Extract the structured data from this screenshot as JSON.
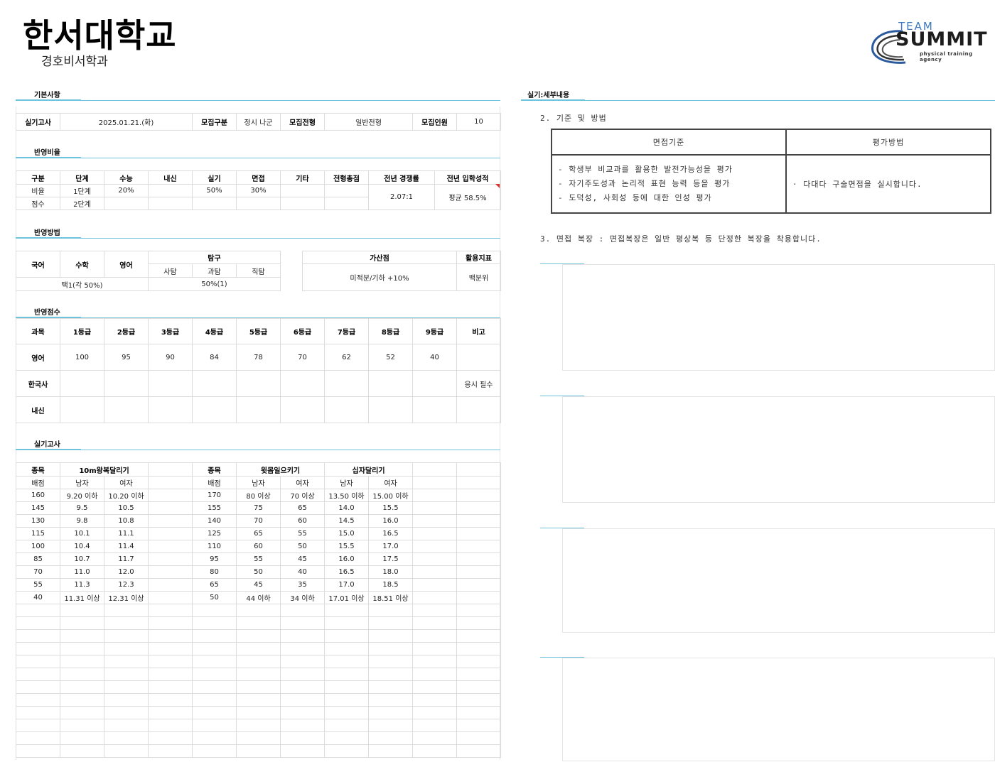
{
  "header": {
    "university": "한서대학교",
    "department": "경호비서학과"
  },
  "logo": {
    "team": "TEAM",
    "summit": "SUMMIT",
    "tagline": "physical training agency"
  },
  "basic": {
    "title": "기본사항",
    "exam_date_label": "실기고사",
    "exam_date": "2025.01.21.(화)",
    "rec_type_label": "모집구분",
    "rec_type": "정시 나군",
    "rec_track_label": "모집전형",
    "rec_track": "일반전형",
    "quota_label": "모집인원",
    "quota": "10"
  },
  "ratio": {
    "title": "반영비율",
    "headers": [
      "구분",
      "단계",
      "수능",
      "내신",
      "실기",
      "면접",
      "기타",
      "전형총점",
      "전년 경쟁률",
      "전년 입학성적"
    ],
    "row1": [
      "비율",
      "1단계",
      "20%",
      "",
      "50%",
      "30%",
      "",
      ""
    ],
    "row2": [
      "점수",
      "2단계",
      "",
      "",
      "",
      "",
      "",
      ""
    ],
    "prev_competition": "2.07:1",
    "prev_score": "평균 58.5%"
  },
  "method": {
    "title": "반영방법",
    "korean": "국어",
    "math": "수학",
    "english": "영어",
    "inquiry": "탐구",
    "social": "사탐",
    "science": "과탐",
    "vocational": "직탐",
    "choice": "택1(각 50%)",
    "inquiry_value": "50%(1)",
    "bonus_label": "가산점",
    "bonus_value": "미적분/기하 +10%",
    "index_label": "활용지표",
    "index_value": "백분위"
  },
  "grade_scores": {
    "title": "반영점수",
    "headers": [
      "과목",
      "1등급",
      "2등급",
      "3등급",
      "4등급",
      "5등급",
      "6등급",
      "7등급",
      "8등급",
      "9등급",
      "비고"
    ],
    "rows": [
      [
        "영어",
        "100",
        "95",
        "90",
        "84",
        "78",
        "70",
        "62",
        "52",
        "40",
        ""
      ],
      [
        "한국사",
        "",
        "",
        "",
        "",
        "",
        "",
        "",
        "",
        "",
        "응시 필수"
      ],
      [
        "내신",
        "",
        "",
        "",
        "",
        "",
        "",
        "",
        "",
        "",
        ""
      ]
    ]
  },
  "practical": {
    "title": "실기고사",
    "left_event_label": "종목",
    "left_event": "10m왕복달리기",
    "right_event_label": "종목",
    "right_event1": "윗몸일으키기",
    "right_event2": "십자달리기",
    "score_label": "배점",
    "male": "남자",
    "female": "여자",
    "rows": [
      [
        "160",
        "9.20 이하",
        "10.20 이하",
        "170",
        "80 이상",
        "70 이상",
        "13.50 이하",
        "15.00 이하"
      ],
      [
        "145",
        "9.5",
        "10.5",
        "155",
        "75",
        "65",
        "14.0",
        "15.5"
      ],
      [
        "130",
        "9.8",
        "10.8",
        "140",
        "70",
        "60",
        "14.5",
        "16.0"
      ],
      [
        "115",
        "10.1",
        "11.1",
        "125",
        "65",
        "55",
        "15.0",
        "16.5"
      ],
      [
        "100",
        "10.4",
        "11.4",
        "110",
        "60",
        "50",
        "15.5",
        "17.0"
      ],
      [
        "85",
        "10.7",
        "11.7",
        "95",
        "55",
        "45",
        "16.0",
        "17.5"
      ],
      [
        "70",
        "11.0",
        "12.0",
        "80",
        "50",
        "40",
        "16.5",
        "18.0"
      ],
      [
        "55",
        "11.3",
        "12.3",
        "65",
        "45",
        "35",
        "17.0",
        "18.5"
      ],
      [
        "40",
        "11.31 이상",
        "12.31 이상",
        "50",
        "44 이하",
        "34 이하",
        "17.01 이상",
        "18.51 이상"
      ]
    ]
  },
  "details": {
    "title": "실기:세부내용",
    "section2": "2. 기준 및 방법",
    "criteria_header": "면접기준",
    "method_header": "평가방법",
    "criteria": [
      "- 학생부 비교과를 활용한 발전가능성을 평가",
      "- 자기주도성과 논리적 표현 능력 등을 평가",
      "- 도덕성, 사회성 등에 대한 인성 평가"
    ],
    "method": "· 다대다 구술면접을 실시합니다.",
    "section3": "3. 면접 복장 : 면접복장은 일반 평상복 등 단정한 복장을 착용합니다."
  }
}
